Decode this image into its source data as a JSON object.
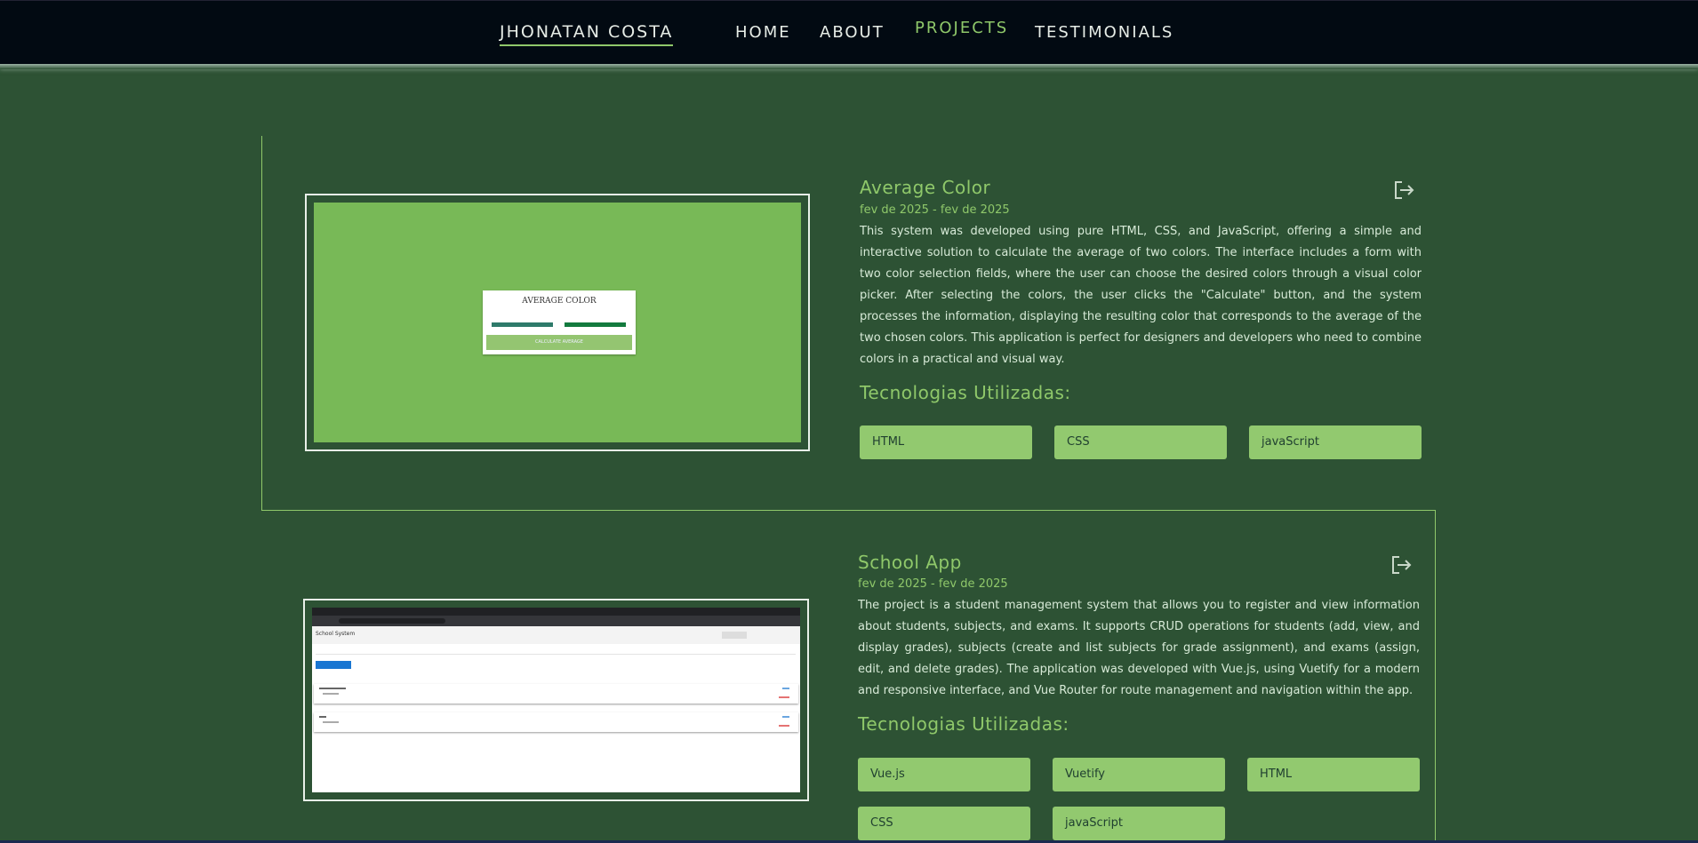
{
  "nav": {
    "brand": "JHONATAN COSTA",
    "links": [
      "HOME",
      "ABOUT",
      "PROJECTS",
      "TESTIMONIALS"
    ],
    "active": "PROJECTS"
  },
  "projects": [
    {
      "title": "Average Color",
      "date": "fev de 2025 - fev de 2025",
      "description": "This system was developed using pure HTML, CSS, and JavaScript, offering a simple and interactive solution to calculate the average of two colors. The interface includes a form with two color selection fields, where the user can choose the desired colors through a visual color picker. After selecting the colors, the user clicks the \"Calculate\" button, and the system processes the information, displaying the resulting color that corresponds to the average of the two chosen colors. This application is perfect for designers and developers who need to combine colors in a practical and visual way.",
      "tech_heading": "Tecnologias Utilizadas:",
      "technologies": [
        "HTML",
        "CSS",
        "javaScript"
      ],
      "preview": {
        "title": "AVERAGE COLOR",
        "button": "CALCULATE AVERAGE"
      },
      "icon": "exit-icon"
    },
    {
      "title": "School App",
      "date": "fev de 2025 - fev de 2025",
      "description": "The project is a student management system that allows you to register and view information about students, subjects, and exams. It supports CRUD operations for students (add, view, and display grades), subjects (create and list subjects for grade assignment), and exams (assign, edit, and delete grades). The application was developed with Vue.js, using Vuetify for a modern and responsive interface, and Vue Router for route management and navigation within the app.",
      "tech_heading": "Tecnologias Utilizadas:",
      "technologies": [
        "Vue.js",
        "Vuetify",
        "HTML",
        "CSS",
        "javaScript"
      ],
      "preview": {
        "title": "School System"
      },
      "icon": "exit-icon"
    }
  ],
  "colors": {
    "background": "#2d5234",
    "accent": "#8fc86a",
    "chip": "#92c96f",
    "nav": "#020a12"
  }
}
